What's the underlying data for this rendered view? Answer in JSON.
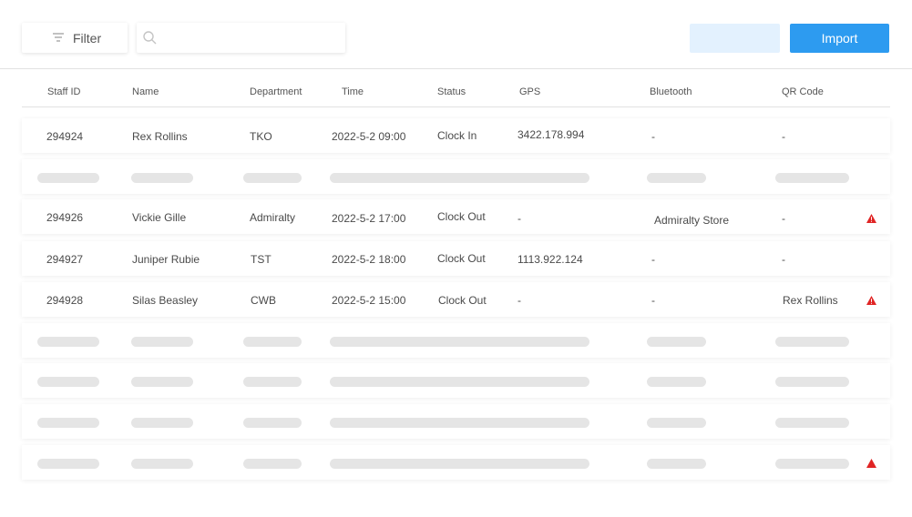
{
  "toolbar": {
    "filter_label": "Filter",
    "search_placeholder": "",
    "search_value": "",
    "blank_button_label": "",
    "import_label": "Import"
  },
  "columns": {
    "staff_id": "Staff ID",
    "name": "Name",
    "department": "Department",
    "time": "Time",
    "status": "Status",
    "gps": "GPS",
    "bluetooth": "Bluetooth",
    "qr_code": "QR Code"
  },
  "rows": [
    {
      "staff_id": "294924",
      "name": "Rex Rollins",
      "department": "TKO",
      "time": "2022-5-2 09:00",
      "status": "Clock In",
      "gps": "3422.178.994",
      "bluetooth": "-",
      "qr_code": "-"
    },
    {
      "staff_id": "294926",
      "name": "Vickie Gille",
      "department": "Admiralty",
      "time": "2022-5-2 17:00",
      "status": "Clock Out",
      "gps": "-",
      "bluetooth": "Admiralty Store",
      "qr_code": "-"
    },
    {
      "staff_id": "294927",
      "name": "Juniper Rubie",
      "department": "TST",
      "time": "2022-5-2 18:00",
      "status": "Clock Out",
      "gps": "1113.922.124",
      "bluetooth": "-",
      "qr_code": "-"
    },
    {
      "staff_id": "294928",
      "name": "Silas Beasley",
      "department": "CWB",
      "time": "2022-5-2 15:00",
      "status": "Clock Out",
      "gps": "-",
      "bluetooth": "-",
      "qr_code": "Rex Rollins"
    }
  ],
  "icons": {
    "filter": "filter-icon",
    "search": "search-icon",
    "warning": "warning-icon"
  },
  "colors": {
    "accent": "#2d9bf0",
    "accent_light": "#e3f1fe",
    "warning": "#e02424",
    "skeleton": "#e5e5e5"
  }
}
